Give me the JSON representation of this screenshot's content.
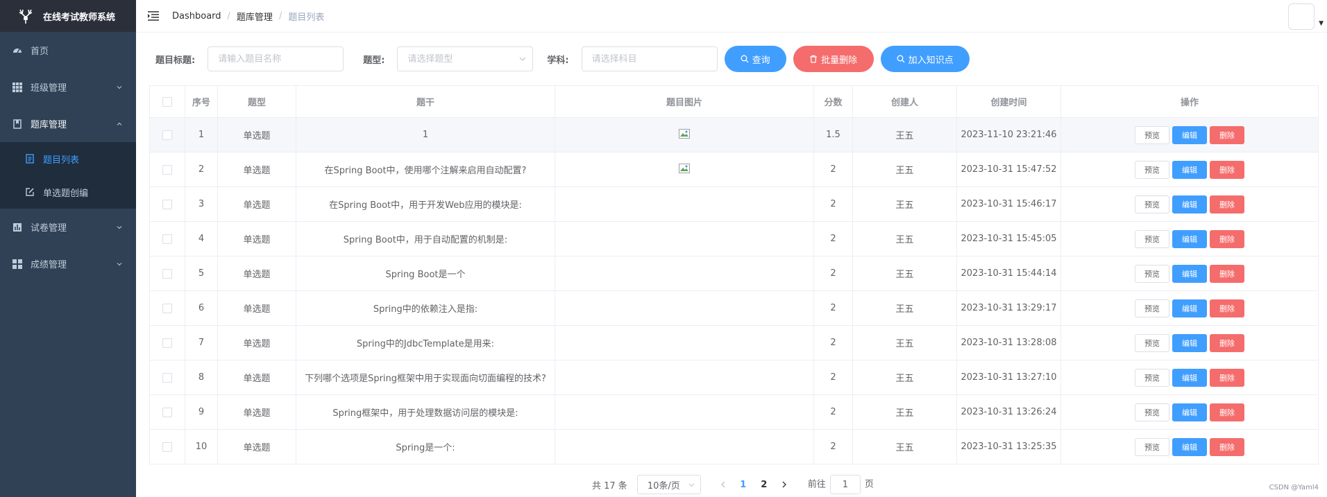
{
  "colors": {
    "sidebar_bg": "#304156",
    "primary": "#409eff",
    "danger": "#f56c6c"
  },
  "sidebar": {
    "title": "在线考试教师系统",
    "items": [
      {
        "label": "首页",
        "icon": "dashboard-icon"
      },
      {
        "label": "班级管理",
        "icon": "grid-icon"
      },
      {
        "label": "题库管理",
        "icon": "book-icon",
        "expanded": true,
        "children": [
          {
            "label": "题目列表",
            "icon": "document-icon",
            "active": true
          },
          {
            "label": "单选题创编",
            "icon": "edit-icon"
          }
        ]
      },
      {
        "label": "试卷管理",
        "icon": "chart-icon"
      },
      {
        "label": "成绩管理",
        "icon": "apps-icon"
      }
    ]
  },
  "navbar": {
    "breadcrumb": [
      "Dashboard",
      "题库管理",
      "题目列表"
    ]
  },
  "filters": {
    "title_label": "题目标题:",
    "title_placeholder": "请输入题目名称",
    "type_label": "题型:",
    "type_placeholder": "请选择题型",
    "subject_label": "学科:",
    "subject_placeholder": "请选择科目",
    "query_button": "查询",
    "batch_delete_button": "批量删除",
    "add_knowledge_button": "加入知识点"
  },
  "table": {
    "headers": [
      "序号",
      "题型",
      "题干",
      "题目图片",
      "分数",
      "创建人",
      "创建时间",
      "操作"
    ],
    "actions": {
      "preview": "预览",
      "edit": "编辑",
      "delete": "删除"
    },
    "rows": [
      {
        "no": "1",
        "type": "单选题",
        "stem": "1",
        "has_image": true,
        "score": "1.5",
        "creator": "王五",
        "created": "2023-11-10 23:21:46"
      },
      {
        "no": "2",
        "type": "单选题",
        "stem": "在Spring Boot中，使用哪个注解来启用自动配置?",
        "has_image": true,
        "score": "2",
        "creator": "王五",
        "created": "2023-10-31 15:47:52"
      },
      {
        "no": "3",
        "type": "单选题",
        "stem": "在Spring Boot中，用于开发Web应用的模块是:",
        "has_image": false,
        "score": "2",
        "creator": "王五",
        "created": "2023-10-31 15:46:17"
      },
      {
        "no": "4",
        "type": "单选题",
        "stem": "Spring Boot中，用于自动配置的机制是:",
        "has_image": false,
        "score": "2",
        "creator": "王五",
        "created": "2023-10-31 15:45:05"
      },
      {
        "no": "5",
        "type": "单选题",
        "stem": "Spring Boot是一个",
        "has_image": false,
        "score": "2",
        "creator": "王五",
        "created": "2023-10-31 15:44:14"
      },
      {
        "no": "6",
        "type": "单选题",
        "stem": "Spring中的依赖注入是指:",
        "has_image": false,
        "score": "2",
        "creator": "王五",
        "created": "2023-10-31 13:29:17"
      },
      {
        "no": "7",
        "type": "单选题",
        "stem": "Spring中的JdbcTemplate是用来:",
        "has_image": false,
        "score": "2",
        "creator": "王五",
        "created": "2023-10-31 13:28:08"
      },
      {
        "no": "8",
        "type": "单选题",
        "stem": "下列哪个选项是Spring框架中用于实现面向切面编程的技术?",
        "has_image": false,
        "score": "2",
        "creator": "王五",
        "created": "2023-10-31 13:27:10"
      },
      {
        "no": "9",
        "type": "单选题",
        "stem": "Spring框架中，用于处理数据访问层的模块是:",
        "has_image": false,
        "score": "2",
        "creator": "王五",
        "created": "2023-10-31 13:26:24"
      },
      {
        "no": "10",
        "type": "单选题",
        "stem": "Spring是一个:",
        "has_image": false,
        "score": "2",
        "creator": "王五",
        "created": "2023-10-31 13:25:35"
      }
    ]
  },
  "pagination": {
    "total": "共 17 条",
    "page_size": "10条/页",
    "pages": [
      "1",
      "2"
    ],
    "current": "1",
    "goto_prefix": "前往",
    "goto_value": "1",
    "goto_suffix": "页"
  },
  "watermark": "CSDN @Yaml4"
}
